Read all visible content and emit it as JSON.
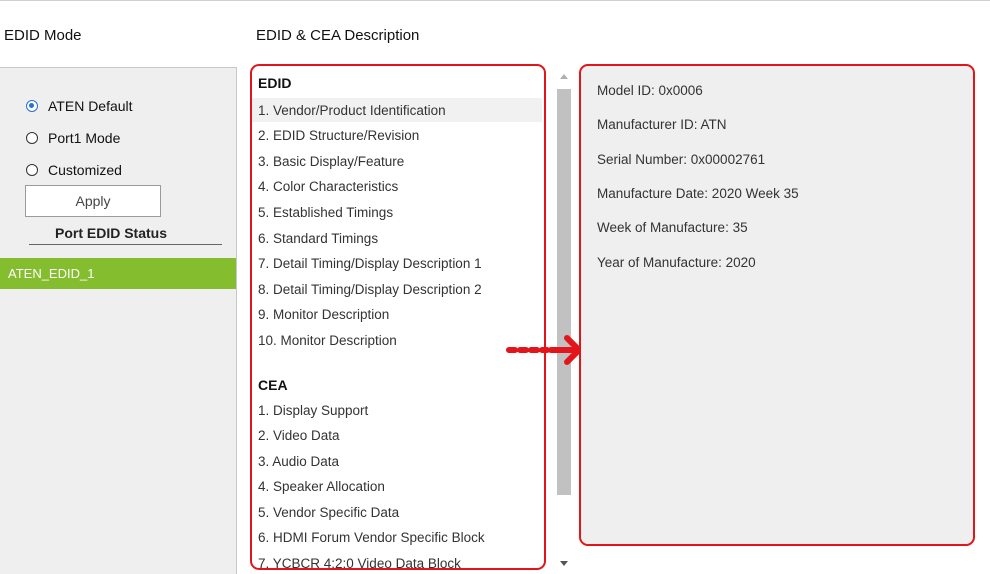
{
  "headers": {
    "edid_mode": "EDID Mode",
    "description": "EDID & CEA Description"
  },
  "mode_options": [
    {
      "label": "ATEN Default",
      "checked": true
    },
    {
      "label": "Port1 Mode",
      "checked": false
    },
    {
      "label": "Customized",
      "checked": false
    }
  ],
  "apply_label": "Apply",
  "port_status": {
    "title": "Port EDID Status",
    "items": [
      "ATEN_EDID_1"
    ]
  },
  "edid": {
    "title": "EDID",
    "items": [
      "1. Vendor/Product Identification",
      "2. EDID Structure/Revision",
      "3. Basic Display/Feature",
      "4. Color Characteristics",
      "5. Established Timings",
      "6. Standard Timings",
      "7. Detail Timing/Display Description 1",
      "8. Detail Timing/Display Description 2",
      "9. Monitor Description",
      "10. Monitor Description"
    ],
    "selected_index": 0
  },
  "cea": {
    "title": "CEA",
    "items": [
      "1. Display Support",
      "2. Video Data",
      "3. Audio Data",
      "4. Speaker Allocation",
      "5. Vendor Specific Data",
      "6. HDMI Forum Vendor Specific Block",
      "7. YCBCR 4:2:0 Video Data Block"
    ]
  },
  "details": [
    "Model ID: 0x0006",
    "Manufacturer ID: ATN",
    "Serial Number: 0x00002761",
    "Manufacture Date: 2020 Week 35",
    "Week of Manufacture: 35",
    "Year of Manufacture: 2020"
  ],
  "colors": {
    "accent_red": "#e2151b",
    "selected_green": "#84bd2e",
    "radio_blue": "#2a6fd6"
  }
}
